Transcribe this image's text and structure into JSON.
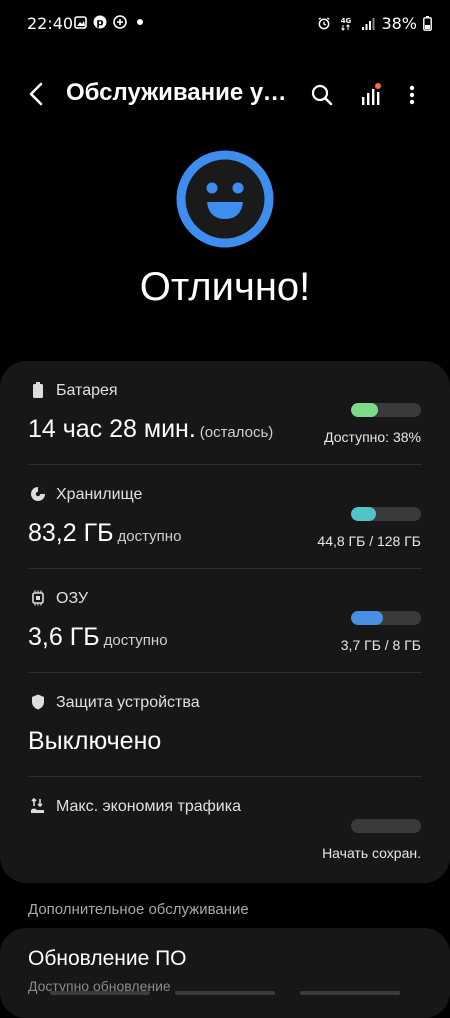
{
  "status_bar": {
    "time": "22:40",
    "battery_percent": "38%",
    "network": "4G",
    "left_icons": [
      "gallery-icon",
      "pinterest-icon",
      "messenger-icon",
      "dot-icon"
    ],
    "right_icons": [
      "alarm-icon",
      "network-4g-icon",
      "signal-icon",
      "battery-icon"
    ]
  },
  "header": {
    "title": "Обслуживание устройства",
    "back_icon": "back-icon",
    "search_icon": "search-icon",
    "diagnostics_icon": "diagnostics-icon",
    "more_icon": "more-icon"
  },
  "status": {
    "icon": "happy-face-icon",
    "heading": "Отлично!"
  },
  "rows": [
    {
      "id": "battery",
      "icon": "battery-icon",
      "label": "Батарея",
      "value": "14 час 28 мин.",
      "value_suffix": "(осталось)",
      "right_text": "Доступно: 38%",
      "level": 0.38,
      "color": "#7ed98a"
    },
    {
      "id": "storage",
      "icon": "storage-icon",
      "label": "Хранилище",
      "value": "83,2 ГБ",
      "value_suffix": "доступно",
      "right_text": "44,8 ГБ / 128 ГБ",
      "level": 0.35,
      "color": "#4fc3c8"
    },
    {
      "id": "ram",
      "icon": "memory-chip-icon",
      "label": "ОЗУ",
      "value": "3,6 ГБ",
      "value_suffix": "доступно",
      "right_text": "3,7 ГБ / 8 ГБ",
      "level": 0.46,
      "color": "#4a8fe0"
    },
    {
      "id": "security",
      "icon": "shield-icon",
      "label": "Защита устройства",
      "value": "Выключено",
      "value_suffix": "",
      "right_text": "",
      "level": null,
      "color": ""
    },
    {
      "id": "data_saver",
      "icon": "data-saver-icon",
      "label": "Макс. экономия трафика",
      "value": "",
      "value_suffix": "",
      "right_text": "Начать сохран.",
      "level": 0,
      "color": "#3a3a3a"
    }
  ],
  "additional": {
    "section_title": "Дополнительное обслуживание",
    "item_title": "Обновление ПО",
    "item_subtitle": "Доступно обновление"
  },
  "colors": {
    "background": "#000000",
    "card": "#171717",
    "smiley_ring": "#3e8ef0",
    "smiley_fill": "#1a1a1a",
    "battery_bar": "#7ed98a",
    "storage_bar": "#4fc3c8",
    "ram_bar": "#4a8fe0",
    "badge": "#ff6a3d"
  }
}
